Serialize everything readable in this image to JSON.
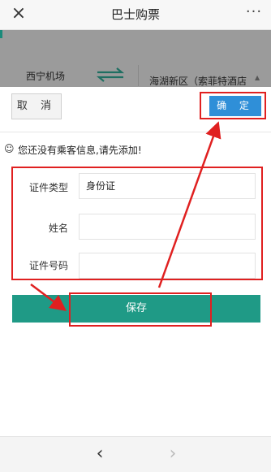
{
  "header": {
    "close_icon": "×",
    "title": "巴士购票",
    "more_icon": "···"
  },
  "background": {
    "from_station": "西宁机场",
    "to_station": "海湖新区（索菲特酒店",
    "swap_icon": "swap-arrows",
    "caret": "▲"
  },
  "popup": {
    "cancel_label": "取 消",
    "confirm_label": "确 定",
    "notice_icon": "☺",
    "notice_text": "您还没有乘客信息,请先添加!",
    "form": {
      "id_type_label": "证件类型",
      "id_type_value": "身份证",
      "name_label": "姓名",
      "name_value": "",
      "id_number_label": "证件号码",
      "id_number_value": ""
    },
    "save_label": "保存"
  },
  "bottom_nav": {
    "back_icon": "‹",
    "forward_icon": "›"
  },
  "colors": {
    "annotation_red": "#e02020",
    "confirm_blue": "#2f8fd8",
    "save_teal": "#1f9a86"
  }
}
